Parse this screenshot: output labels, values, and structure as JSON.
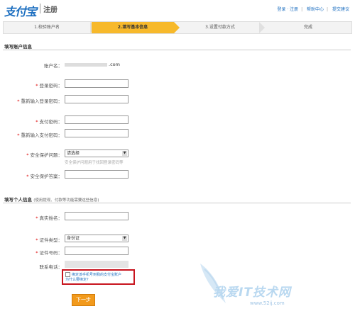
{
  "header": {
    "logo_text": "支付宝",
    "subtitle": "注册",
    "links": [
      "登录 · 注册",
      "帮助中心",
      "提交建议"
    ]
  },
  "steps": [
    {
      "label": "1.校验账户名"
    },
    {
      "label": "2.填写基本信息"
    },
    {
      "label": "3.设置付款方式"
    },
    {
      "label": "完成"
    }
  ],
  "account_section": {
    "title": "填写账户信息",
    "account_label": "账户名：",
    "account_suffix": ".com",
    "login_pwd_label": "登录密码：",
    "login_pwd_confirm_label": "重新输入登录密码：",
    "pay_pwd_label": "支付密码：",
    "pay_pwd_confirm_label": "重新输入支付密码：",
    "question_label": "安全保护问题：",
    "question_value": "请选择",
    "question_hint": "安全保护问题用于找回登录密码等",
    "answer_label": "安全保护答案："
  },
  "personal_section": {
    "title": "填写个人信息",
    "title_note": "(使用提现、付款等功能需要这些信息)",
    "realname_label": "真实姓名：",
    "idtype_label": "证件类型：",
    "idtype_value": "身份证",
    "idnum_label": "证件号码：",
    "phone_label": "联系电话：",
    "bind_text": "绑定该手机号到我的支付宝账户",
    "bind_link": "为什么要绑定？"
  },
  "next_button": "下一步",
  "watermark": {
    "text": "我爱IT技术网",
    "url": "www.52ij.com"
  },
  "colors": {
    "accent": "#f7b92b",
    "brand": "#1d6fc0",
    "required": "#dd0000",
    "highlight_box": "#c8141e",
    "button": "#f29a1c"
  }
}
